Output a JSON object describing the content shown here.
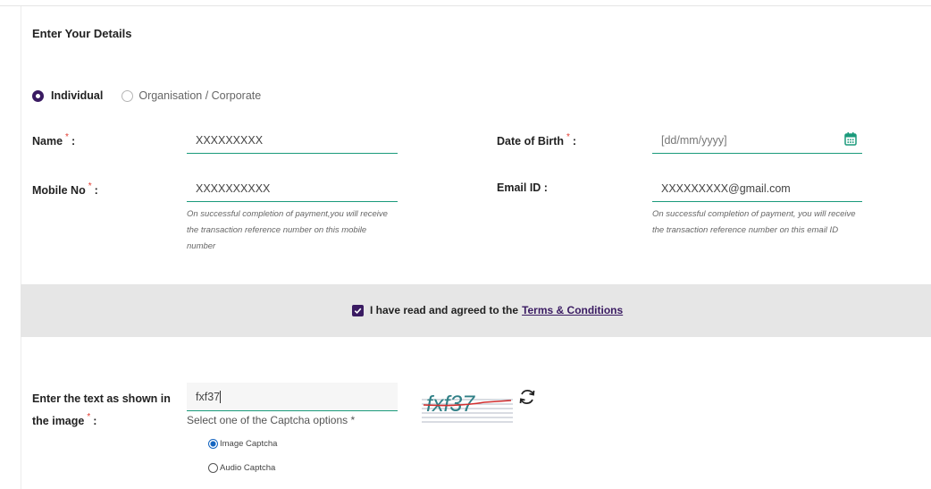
{
  "form": {
    "title": "Enter Your Details",
    "user_type": {
      "options": [
        "Individual",
        "Organisation / Corporate"
      ],
      "selected": "Individual"
    },
    "name": {
      "label": "Name",
      "colon": ":",
      "value": "XXXXXXXXX"
    },
    "dob": {
      "label": "Date of Birth",
      "colon": ":",
      "placeholder": "[dd/mm/yyyy]",
      "icon": "calendar-icon"
    },
    "mobile": {
      "label": "Mobile No",
      "colon": ":",
      "value": "XXXXXXXXXX",
      "hint_lines": [
        "On successful completion of payment,you will receive",
        "the transaction reference number on this mobile",
        "number"
      ]
    },
    "email": {
      "label": "Email ID :",
      "value": "XXXXXXXXX@gmail.com",
      "hint_lines": [
        "On successful completion of payment, you will receive",
        "the transaction reference number on this email ID"
      ]
    },
    "required_mark": "*"
  },
  "terms": {
    "checked": true,
    "text": "I have read and agreed to the",
    "link": "Terms & Conditions"
  },
  "captcha": {
    "label_line1": "Enter the text as shown in",
    "label_line2": "the image",
    "colon": ":",
    "input_value": "fxf37",
    "image_text": "fxf37",
    "options_title": "Select one of the Captcha options *",
    "options": [
      "Image Captcha",
      "Audio Captcha"
    ],
    "selected": "Image Captcha",
    "refresh_icon": "refresh-icon"
  },
  "colors": {
    "accent": "#3a1b62",
    "underline": "#1a9a7b",
    "required": "#e23a2f",
    "calendar": "#1a9a7b",
    "radio_blue": "#1565c0"
  }
}
